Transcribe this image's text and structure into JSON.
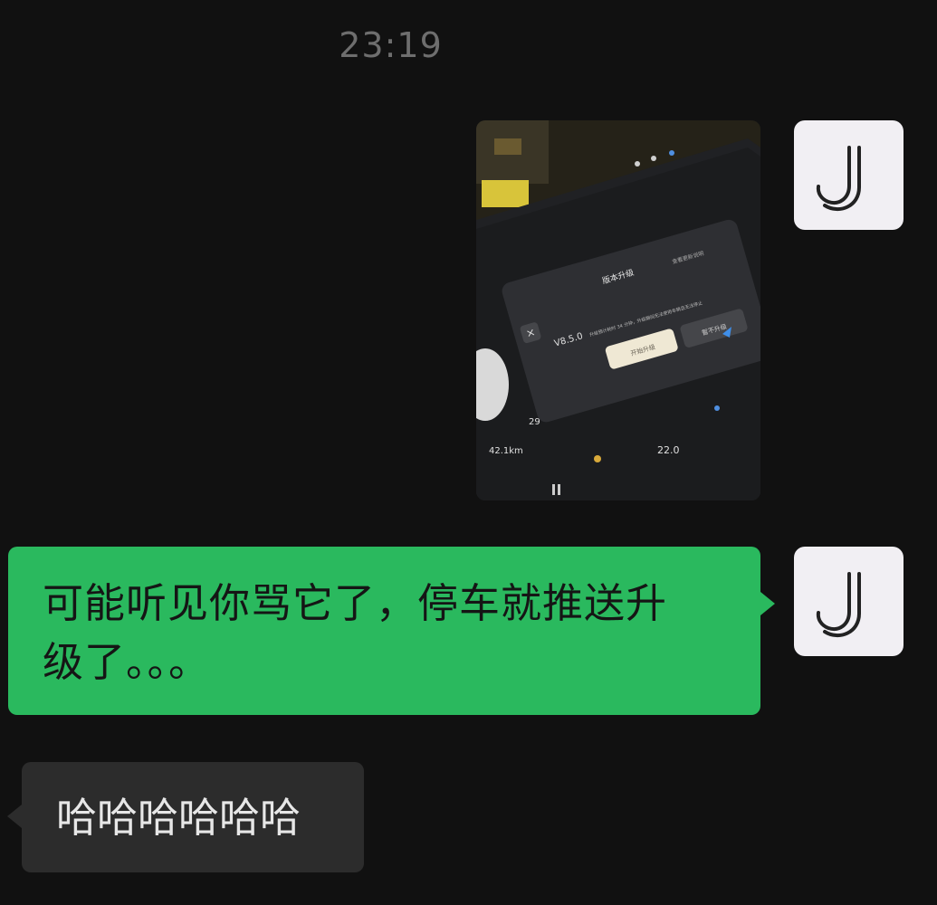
{
  "chat": {
    "timestamp": "23:19",
    "messages": [
      {
        "sender": "me",
        "type": "image",
        "image": {
          "dialog_title": "版本升级",
          "version": "V8.5.0",
          "details_link": "查看更新说明",
          "notice": "升级预计耗时 34 分钟，升级期间无法使用车辆且无法停止",
          "primary_button": "开始升级",
          "secondary_button": "暂不升级",
          "distance": "42.1km",
          "temperature": "22.0",
          "small_value": "29"
        }
      },
      {
        "sender": "me",
        "type": "text",
        "text_line1": "可能听见你骂它了，停车就推送升",
        "text_line2": "级了。。。"
      },
      {
        "sender": "other",
        "type": "text",
        "text": "哈哈哈哈哈哈"
      }
    ],
    "avatar_icon": "j-logo-icon",
    "colors": {
      "background": "#111111",
      "sent_bubble": "#2ab95e",
      "received_bubble": "#2c2c2c"
    }
  }
}
